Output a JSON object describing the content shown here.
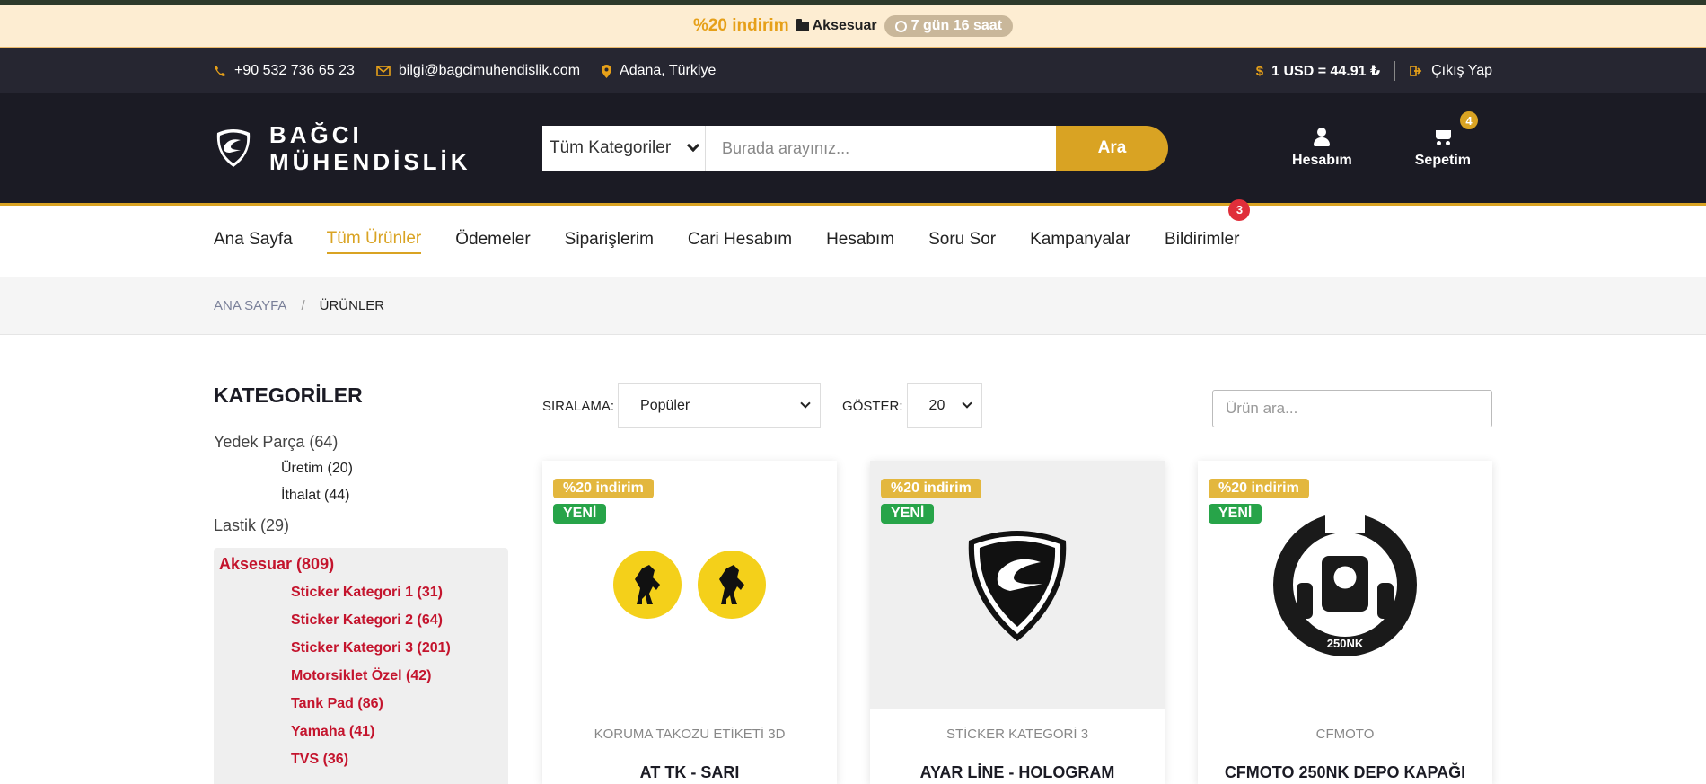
{
  "promo": {
    "discount": "%20 indirim",
    "category": "Aksesuar",
    "timer": "7 gün 16 saat"
  },
  "infobar": {
    "phone": "+90 532 736 65 23",
    "email": "bilgi@bagcimuhendislik.com",
    "location": "Adana, Türkiye",
    "currency": "1 USD = 44.91 ₺",
    "logout": "Çıkış Yap"
  },
  "header": {
    "brand_line1": "BAĞCI",
    "brand_line2": "MÜHENDİSLİK",
    "category_select": "Tüm Kategoriler",
    "search_placeholder": "Burada arayınız...",
    "search_button": "Ara",
    "account_label": "Hesabım",
    "cart_label": "Sepetim",
    "cart_count": "4"
  },
  "nav": {
    "items": [
      {
        "label": "Ana Sayfa"
      },
      {
        "label": "Tüm Ürünler"
      },
      {
        "label": "Ödemeler"
      },
      {
        "label": "Siparişlerim"
      },
      {
        "label": "Cari Hesabım"
      },
      {
        "label": "Hesabım"
      },
      {
        "label": "Soru Sor"
      },
      {
        "label": "Kampanyalar"
      },
      {
        "label": "Bildirimler"
      }
    ],
    "notification_count": "3"
  },
  "breadcrumb": {
    "home": "ANA SAYFA",
    "separator": "/",
    "current": "ÜRÜNLER"
  },
  "sidebar": {
    "title": "KATEGORİLER",
    "cat1": "Yedek Parça (64)",
    "cat1_sub1": "Üretim (20)",
    "cat1_sub2": "İthalat (44)",
    "cat2": "Lastik (29)",
    "cat3": "Aksesuar (809)",
    "cat3_subs": [
      "Sticker Kategori 1 (31)",
      "Sticker Kategori 2 (64)",
      "Sticker Kategori 3 (201)",
      "Motorsiklet Özel (42)",
      "Tank Pad (86)",
      "Yamaha (41)",
      "TVS (36)"
    ]
  },
  "toolbar": {
    "sort_label": "SIRALAMA:",
    "sort_value": "Popüler",
    "show_label": "GÖSTER:",
    "show_value": "20",
    "search_placeholder": "Ürün ara..."
  },
  "products": [
    {
      "discount": "%20 indirim",
      "new": "YENİ",
      "category": "KORUMA TAKOZU ETİKETİ 3D",
      "name": "AT TK - SARI"
    },
    {
      "discount": "%20 indirim",
      "new": "YENİ",
      "category": "STİCKER KATEGORİ 3",
      "name": "AYAR LİNE - HOLOGRAM"
    },
    {
      "discount": "%20 indirim",
      "new": "YENİ",
      "category": "CFMOTO",
      "name": "CFMOTO 250NK DEPO KAPAĞI",
      "image_text": "250NK"
    }
  ],
  "colors": {
    "accent": "#d9a323",
    "header_bg": "#1b1b24",
    "active_category": "#c4142d",
    "new_badge": "#27a449"
  }
}
